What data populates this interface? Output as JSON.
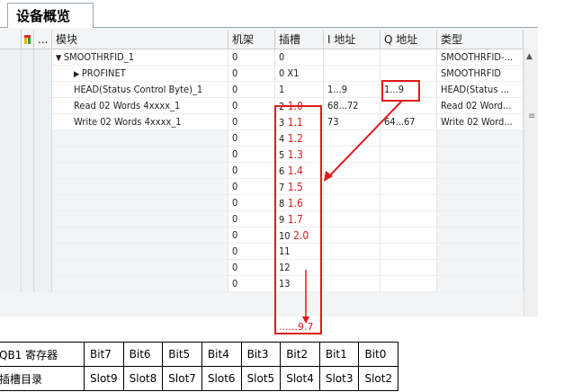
{
  "tab": {
    "label": "设备概览"
  },
  "header": {
    "dots": "...",
    "module": "模块",
    "rack": "机架",
    "slot": "插槽",
    "iaddr": "I 地址",
    "qaddr": "Q 地址",
    "type": "类型"
  },
  "rows": [
    {
      "expander": "▼",
      "name": "SMOOTHRFID_1",
      "rack": "0",
      "slot": "0",
      "slot_red": "",
      "iaddr": "",
      "qaddr": "",
      "type": "SMOOTHRFID-..."
    },
    {
      "expander": "▶",
      "name": "PROFINET",
      "rack": "0",
      "slot": "0 X1",
      "slot_red": "",
      "iaddr": "",
      "qaddr": "",
      "type": "SMOOTHRFID"
    },
    {
      "expander": "",
      "name": "HEAD(Status Control Byte)_1",
      "rack": "0",
      "slot": "1",
      "slot_red": "",
      "iaddr": "1...9",
      "qaddr": "1...9",
      "type": "HEAD(Status ..."
    },
    {
      "expander": "",
      "name": "Read 02 Words 4xxxx_1",
      "rack": "0",
      "slot": "2",
      "slot_red": "1.0",
      "iaddr": "68...72",
      "qaddr": "",
      "type": "Read 02 Word..."
    },
    {
      "expander": "",
      "name": "Write 02 Words 4xxxx_1",
      "rack": "0",
      "slot": "3",
      "slot_red": "1.1",
      "iaddr": "73",
      "qaddr": "64...67",
      "type": "Write 02 Word..."
    },
    {
      "expander": "",
      "name": "",
      "rack": "0",
      "slot": "4",
      "slot_red": "1.2",
      "iaddr": "",
      "qaddr": "",
      "type": ""
    },
    {
      "expander": "",
      "name": "",
      "rack": "0",
      "slot": "5",
      "slot_red": "1.3",
      "iaddr": "",
      "qaddr": "",
      "type": ""
    },
    {
      "expander": "",
      "name": "",
      "rack": "0",
      "slot": "6",
      "slot_red": "1.4",
      "iaddr": "",
      "qaddr": "",
      "type": ""
    },
    {
      "expander": "",
      "name": "",
      "rack": "0",
      "slot": "7",
      "slot_red": "1.5",
      "iaddr": "",
      "qaddr": "",
      "type": ""
    },
    {
      "expander": "",
      "name": "",
      "rack": "0",
      "slot": "8",
      "slot_red": "1.6",
      "iaddr": "",
      "qaddr": "",
      "type": ""
    },
    {
      "expander": "",
      "name": "",
      "rack": "0",
      "slot": "9",
      "slot_red": "1.7",
      "iaddr": "",
      "qaddr": "",
      "type": ""
    },
    {
      "expander": "",
      "name": "",
      "rack": "0",
      "slot": "10",
      "slot_red": "2.0",
      "iaddr": "",
      "qaddr": "",
      "type": ""
    },
    {
      "expander": "",
      "name": "",
      "rack": "0",
      "slot": "11",
      "slot_red": "",
      "iaddr": "",
      "qaddr": "",
      "type": ""
    },
    {
      "expander": "",
      "name": "",
      "rack": "0",
      "slot": "12",
      "slot_red": "",
      "iaddr": "",
      "qaddr": "",
      "type": ""
    },
    {
      "expander": "",
      "name": "",
      "rack": "0",
      "slot": "13",
      "slot_red": "",
      "iaddr": "",
      "qaddr": "",
      "type": ""
    }
  ],
  "annotation": {
    "range_end": "......9.7",
    "accent": "#e11a1a"
  },
  "bits_table": {
    "row1": [
      "QB1 寄存器",
      "Bit7",
      "Bit6",
      "Bit5",
      "Bit4",
      "Bit3",
      "Bit2",
      "Bit1",
      "Bit0"
    ],
    "row2": [
      "插槽目录",
      "Slot9",
      "Slot8",
      "Slot7",
      "Slot6",
      "Slot5",
      "Slot4",
      "Slot3",
      "Slot2"
    ]
  },
  "icons": {
    "filter": "filter-icon",
    "scroll_up": "chevron-up-icon",
    "scroll_grip": "grip-icon"
  }
}
